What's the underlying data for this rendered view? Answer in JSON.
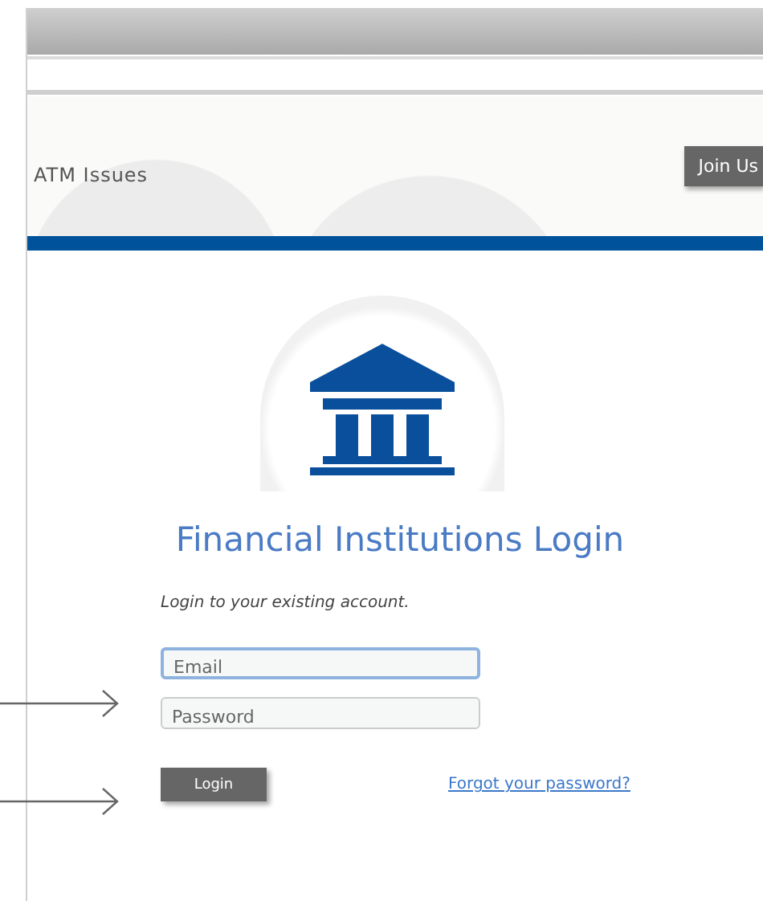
{
  "banner": {
    "nav_link": "ATM Issues",
    "join_button": "Join Us"
  },
  "login": {
    "title": "Financial Institutions Login",
    "subtitle": "Login to your existing account.",
    "fields": [
      {
        "placeholder": "Email",
        "focused": true
      },
      {
        "placeholder": "Password",
        "focused": false
      }
    ],
    "submit_button": "Login",
    "forgot_link": "Forgot your password?"
  },
  "annotation_arrows": [
    {
      "kind": "arrow"
    },
    {
      "kind": "arrow"
    }
  ]
}
